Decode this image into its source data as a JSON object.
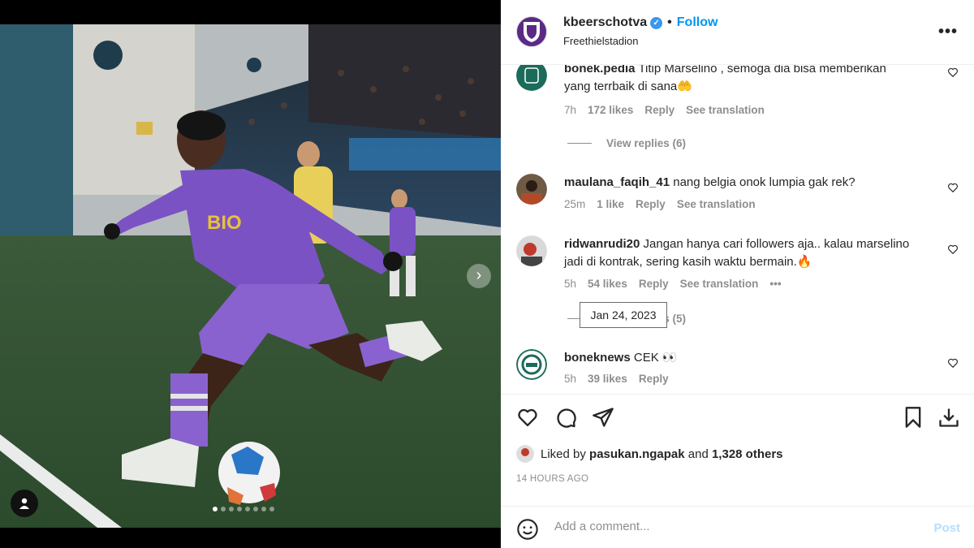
{
  "header": {
    "username": "kbeerschotva",
    "separator": "•",
    "follow_label": "Follow",
    "location": "Freethielstadion",
    "more_icon": "more-horizontal-icon",
    "verified_icon": "verified-badge-icon",
    "verified_glyph": "✓"
  },
  "media": {
    "carousel_total": 8,
    "carousel_current": 1,
    "next_glyph": "›",
    "jersey_text": "BIO"
  },
  "comments": [
    {
      "username": "bonek.pedia",
      "text": "Titip Marselino , semoga dia bisa memberikan yang terrbaik di sana🤲",
      "time": "7h",
      "likes": "172 likes",
      "reply": "Reply",
      "translate": "See translation",
      "view_replies": "View replies (6)"
    },
    {
      "username": "maulana_faqih_41",
      "text": "nang belgia onok lumpia gak rek?",
      "time": "25m",
      "likes": "1 like",
      "reply": "Reply",
      "translate": "See translation"
    },
    {
      "username": "ridwanrudi20",
      "text": "Jangan hanya cari followers aja.. kalau marselino jadi di kontrak, sering kasih waktu bermain.🔥",
      "time": "5h",
      "likes": "54 likes",
      "reply": "Reply",
      "translate": "See translation",
      "options": "•••",
      "view_replies": "View replies (5)"
    },
    {
      "username": "boneknews",
      "text": "CEK 👀",
      "time": "5h",
      "likes": "39 likes",
      "reply": "Reply"
    }
  ],
  "tooltip": "Jan 24, 2023",
  "likes": {
    "prefix": "Liked by",
    "user": "pasukan.ngapak",
    "middle": "and",
    "others": "1,328 others"
  },
  "time_ago": "14 HOURS AGO",
  "add_comment": {
    "placeholder": "Add a comment...",
    "post_label": "Post"
  },
  "colors": {
    "accent": "#0095f6",
    "post_disabled": "#b2dffc",
    "jersey": "#7b52c4",
    "brand": "#5b2a86"
  }
}
